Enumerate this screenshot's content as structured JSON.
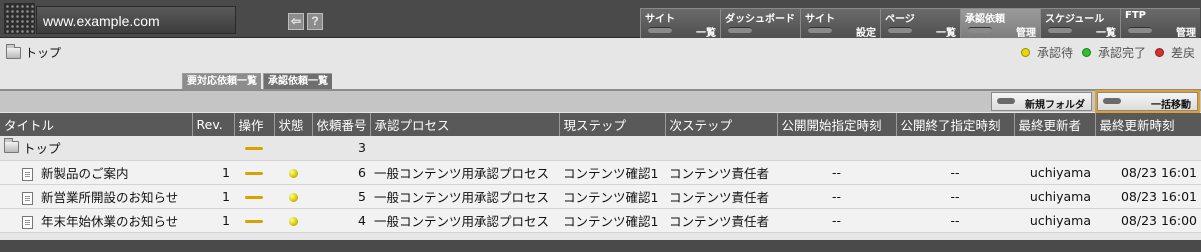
{
  "app": {
    "domain": "www.example.com",
    "back_icon": "back-icon",
    "help_icon": "?"
  },
  "nav_tabs": [
    {
      "top": "サイト",
      "bottom": "一覧",
      "active": false
    },
    {
      "top": "ダッシュボード",
      "bottom": "",
      "active": false
    },
    {
      "top": "サイト",
      "bottom": "設定",
      "active": false
    },
    {
      "top": "ページ",
      "bottom": "一覧",
      "active": false
    },
    {
      "top": "承認依頼",
      "bottom": "管理",
      "active": true
    },
    {
      "top": "スケジュール",
      "bottom": "一覧",
      "active": false
    },
    {
      "top": "FTP",
      "bottom": "管理",
      "active": false
    }
  ],
  "breadcrumb": {
    "label": "トップ"
  },
  "legend": [
    {
      "label": "承認待",
      "color": "#e8d800"
    },
    {
      "label": "承認完了",
      "color": "#2ec02e"
    },
    {
      "label": "差戻",
      "color": "#d83030"
    }
  ],
  "sub_tabs": [
    {
      "label": "要対応依頼一覧",
      "active": true
    },
    {
      "label": "承認依頼一覧",
      "active": false
    }
  ],
  "toolbar": {
    "new_folder": "新規フォルダ",
    "bulk_move": "一括移動"
  },
  "table": {
    "headers": [
      "タイトル",
      "Rev.",
      "操作",
      "状態",
      "依頼番号",
      "承認プロセス",
      "現ステップ",
      "次ステップ",
      "公開開始指定時刻",
      "公開終了指定時刻",
      "最終更新者",
      "最終更新時刻"
    ],
    "folder_row": {
      "title": "トップ",
      "number": "3"
    },
    "rows": [
      {
        "title": "新製品のご案内",
        "rev": "1",
        "number": "6",
        "process": "一般コンテンツ用承認プロセス",
        "current": "コンテンツ確認1",
        "next": "コンテンツ責任者",
        "pub_start": "--",
        "pub_end": "--",
        "updater": "uchiyama",
        "updated": "08/23 16:01"
      },
      {
        "title": "新営業所開設のお知らせ",
        "rev": "1",
        "number": "5",
        "process": "一般コンテンツ用承認プロセス",
        "current": "コンテンツ確認1",
        "next": "コンテンツ責任者",
        "pub_start": "--",
        "pub_end": "--",
        "updater": "uchiyama",
        "updated": "08/23 16:01"
      },
      {
        "title": "年末年始休業のお知らせ",
        "rev": "1",
        "number": "4",
        "process": "一般コンテンツ用承認プロセス",
        "current": "コンテンツ確認1",
        "next": "コンテンツ責任者",
        "pub_start": "--",
        "pub_end": "--",
        "updater": "uchiyama",
        "updated": "08/23 16:00"
      }
    ]
  }
}
